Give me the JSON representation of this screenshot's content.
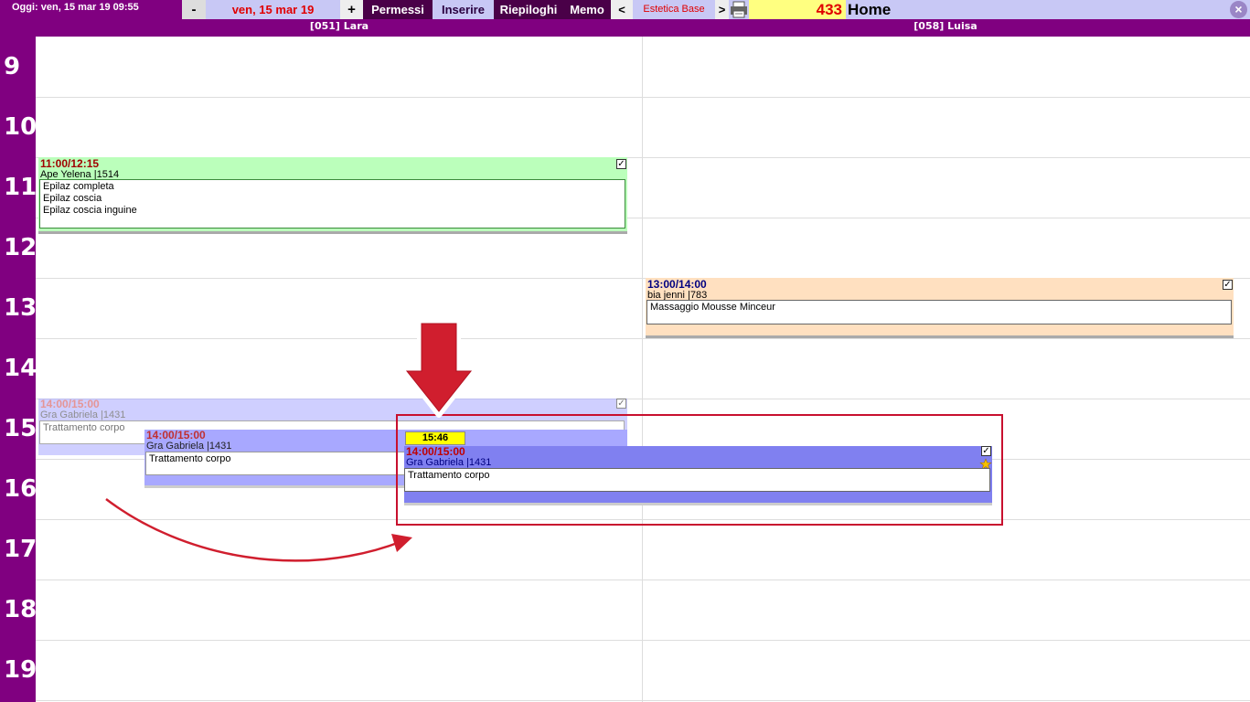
{
  "topbar": {
    "today": "Oggi: ven, 15 mar 19 09:55",
    "prev_label": "-",
    "date": "ven, 15 mar 19",
    "next_label": "+",
    "menu": [
      "Permessi",
      "Inserire",
      "Riepiloghi",
      "Memo"
    ],
    "prev_agenda": "<",
    "agenda_name": "Estetica Base",
    "next_agenda": ">",
    "count": "433",
    "home": "Home",
    "close_label": "×"
  },
  "columns": [
    "[051] Lara",
    "[058] Luisa"
  ],
  "hours": [
    "9",
    "10",
    "11",
    "12",
    "13",
    "14",
    "15",
    "16",
    "17",
    "18",
    "19"
  ],
  "appointments": {
    "a1": {
      "time": "11:00/12:15",
      "client": "Ape Yelena |1514",
      "services": [
        "Epilaz completa",
        "Epilaz coscia",
        "Epilaz coscia inguine"
      ]
    },
    "a2": {
      "time": "13:00/14:00",
      "client": "bia jenni |783",
      "services": [
        "Massaggio Mousse Minceur"
      ]
    },
    "a3": {
      "time": "14:00/15:00",
      "client": "Gra Gabriela |1431",
      "services": [
        "Trattamento corpo"
      ]
    },
    "a4": {
      "time": "14:00/15:00",
      "client": "Gra Gabriela |1431",
      "services": [
        "Trattamento corpo"
      ]
    },
    "a5": {
      "time": "14:00/15:00",
      "client": "Gra Gabriela |1431",
      "services": [
        "Trattamento corpo"
      ]
    }
  },
  "drag_time": "15:46",
  "colors": {
    "purple": "#800080",
    "green_appt": "#bbffbb",
    "orange_appt": "#ffe0c0",
    "blue_appt": "#8080f0",
    "annotation_red": "#c8102e"
  }
}
